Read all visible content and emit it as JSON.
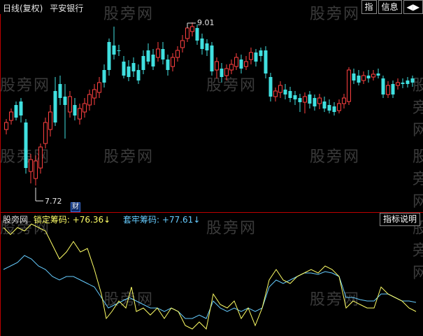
{
  "header": {
    "period_label": "日线(复权)",
    "stock_name": "平安银行",
    "buttons": [
      {
        "label": "指"
      },
      {
        "label": "信息"
      },
      {
        "label": "◀▶"
      }
    ]
  },
  "main_chart": {
    "high_label": "9.01",
    "low_label": "7.72",
    "event_marker": "财"
  },
  "indicator": {
    "name": "股旁网",
    "lock_label": "锁定筹码:",
    "lock_value": "+76.36",
    "lock_arrow": "↓",
    "trap_label": "套牢筹码:",
    "trap_value": "+77.61",
    "trap_arrow": "↓",
    "help_button": "指标说明",
    "lock_color": "#ffff66",
    "trap_color": "#66ccff"
  },
  "watermark": "股旁网",
  "colors": {
    "up": "#ff4040",
    "down": "#40e0e0",
    "axis": "#bb0000"
  }
}
